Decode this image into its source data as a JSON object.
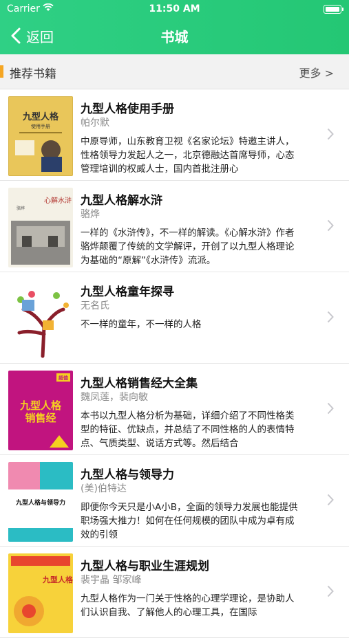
{
  "status_bar": {
    "carrier": "Carrier",
    "time": "11:50 AM"
  },
  "nav": {
    "back_label": "返回",
    "title": "书城"
  },
  "section": {
    "title": "推荐书籍",
    "more_label": "更多 >"
  },
  "books": [
    {
      "title": "九型人格使用手册",
      "author": "帕尔默",
      "description": "中原导师，山东教育卫视《名家论坛》特邀主讲人，性格领导力发起人之一，北京德融达首席导师，心态管理培训的权威人士，国内首批注册心",
      "cover": {
        "bg": "#e9c65a",
        "main_text": "九型人格",
        "sub_text": "使用手册"
      }
    },
    {
      "title": "九型人格解水浒",
      "author": "骆烨",
      "description": "一样的《水浒传》，不一样的解读。《心解水浒》作者骆烨颠覆了传统的文学解评，开创了以九型人格理论为基础的“原解”《水浒传》流派。",
      "cover": {
        "bg": "#f4f1e6",
        "main_text": "心解水浒",
        "sub_text": "骆烨"
      }
    },
    {
      "title": "九型人格童年探寻",
      "author": "无名氏",
      "description": "不一样的童年，不一样的人格",
      "cover": {
        "bg": "#ffffff"
      }
    },
    {
      "title": "九型人格销售经大全集",
      "author": "魏凤莲，裴向敏",
      "description": "本书以九型人格分析为基础，详细介绍了不同性格类型的特征、优缺点，并总结了不同性格的人的表情特点、气质类型、说话方式等。然后结合",
      "cover": {
        "bg": "#c1147f",
        "main_text": "九型人格",
        "sub_text": "销售经",
        "badge": "超值"
      }
    },
    {
      "title": "九型人格与领导力",
      "author": "(美)伯特达",
      "description": "即便你今天只是小A小B，全面的领导力发展也能提供职场强大推力！如何在任何规模的团队中成为卓有成效的引领",
      "cover": {
        "bg": "#ffffff",
        "main_text": "九型人格与领导力"
      }
    },
    {
      "title": "九型人格与职业生涯规划",
      "author": "裴宇晶 邹家峰",
      "description": "九型人格作为一门关于性格的心理学理论，是协助人们认识自我、了解他人的心理工具，在国际",
      "cover": {
        "bg": "#f7d23a",
        "main_text": "九型人格"
      }
    }
  ]
}
